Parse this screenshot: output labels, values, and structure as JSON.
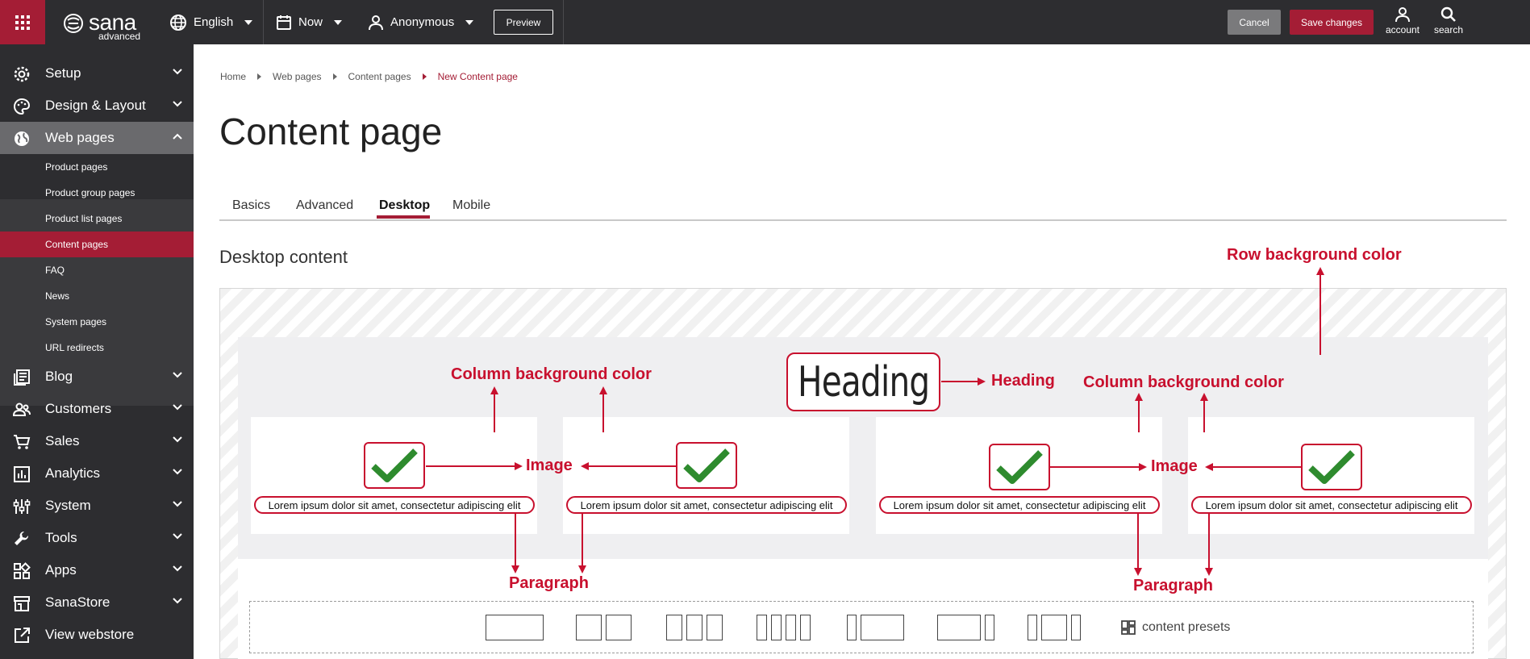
{
  "topbar": {
    "brand": "sana",
    "brand_sub": "advanced",
    "language": "English",
    "date": "Now",
    "user": "Anonymous",
    "preview_label": "Preview",
    "cancel_label": "Cancel",
    "save_label": "Save changes",
    "account_label": "account",
    "search_label": "search"
  },
  "sidebar": {
    "items": [
      {
        "label": "Setup",
        "icon": "gear-icon"
      },
      {
        "label": "Design & Layout",
        "icon": "palette-icon"
      },
      {
        "label": "Web pages",
        "icon": "globe-icon"
      },
      {
        "label": "Blog",
        "icon": "blog-icon"
      },
      {
        "label": "Customers",
        "icon": "customers-icon"
      },
      {
        "label": "Sales",
        "icon": "cart-icon"
      },
      {
        "label": "Analytics",
        "icon": "analytics-icon"
      },
      {
        "label": "System",
        "icon": "sliders-icon"
      },
      {
        "label": "Tools",
        "icon": "wrench-icon"
      },
      {
        "label": "Apps",
        "icon": "apps-icon"
      },
      {
        "label": "SanaStore",
        "icon": "store-icon"
      },
      {
        "label": "View webstore",
        "icon": "external-link-icon"
      }
    ],
    "sub_items": [
      "Product pages",
      "Product group pages",
      "Product list pages",
      "Content pages",
      "FAQ",
      "News",
      "System pages",
      "URL redirects"
    ]
  },
  "breadcrumb": [
    "Home",
    "Web pages",
    "Content pages",
    "New Content page"
  ],
  "page_title": "Content page",
  "tabs": [
    "Basics",
    "Advanced",
    "Desktop",
    "Mobile"
  ],
  "active_tab": "Desktop",
  "section_title": "Desktop content",
  "content": {
    "heading_text": "Heading",
    "lorem": "Lorem ipsum dolor sit amet, consectetur adipiscing elit"
  },
  "annotations": {
    "row_bg": "Row background color",
    "column_bg": "Column background color",
    "heading": "Heading",
    "image": "Image",
    "paragraph": "Paragraph"
  },
  "presets_label": "content presets",
  "colors": {
    "accent": "#a41d35",
    "annotation": "#c8102e",
    "topbar": "#2d2d30",
    "check": "#2e8b2e"
  }
}
